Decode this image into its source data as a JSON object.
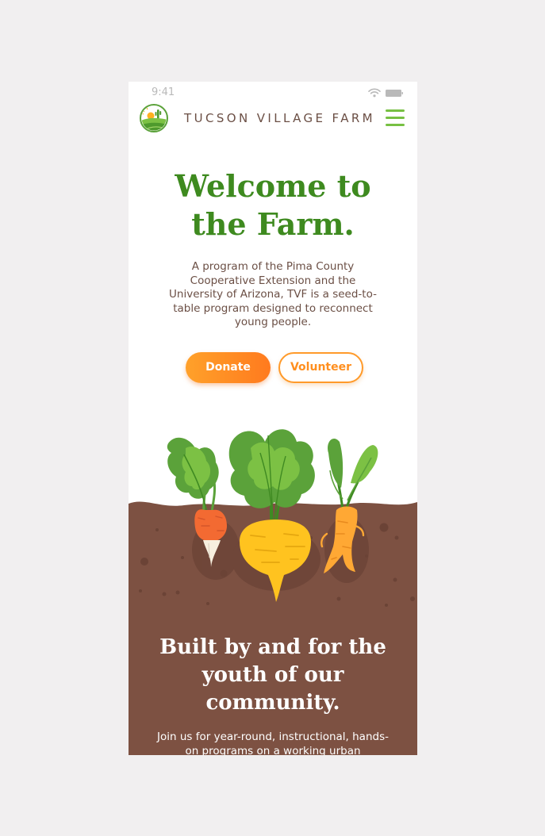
{
  "status_bar": {
    "time": "9:41"
  },
  "header": {
    "brand": "TUCSON VILLAGE FARM"
  },
  "hero": {
    "title_line1": "Welcome to",
    "title_line2": "the Farm.",
    "text": "A program of the Pima County Cooperative Extension and the University of Arizona, TVF is a seed-to-table program designed to reconnect young people."
  },
  "buttons": {
    "donate": "Donate",
    "volunteer": "Volunteer"
  },
  "section": {
    "title_line1": "Built by and for the",
    "title_line2": "youth of our",
    "title_line3": "community.",
    "text": "Join us for year-round, instructional, hands-on programs on a working urban"
  },
  "colors": {
    "page_background": "#f1eff0",
    "brand_green": "#3e8a1f",
    "menu_green": "#77c043",
    "brown_text": "#6b4f45",
    "soil": "#7d5142",
    "accent_orange": "#ff8f1f"
  },
  "icons": {
    "logo": "farm-logo-icon",
    "menu": "hamburger-menu-icon",
    "wifi": "wifi-icon",
    "battery": "battery-icon"
  }
}
